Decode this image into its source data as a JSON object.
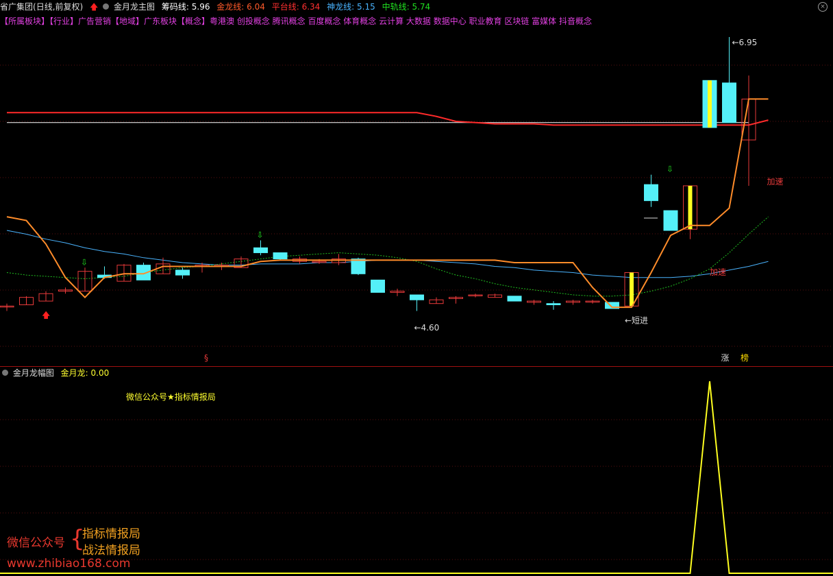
{
  "header": {
    "stock": "省广集团",
    "period": "(日线,前复权)",
    "indicator": "金月龙主图",
    "chip_label": "筹码线:",
    "chip_value": "5.96",
    "gold_label": "金龙线:",
    "gold_value": "6.04",
    "plat_label": "平台线:",
    "plat_value": "6.34",
    "god_label": "神龙线:",
    "god_value": "5.15",
    "mid_label": "中轨线:",
    "mid_value": "5.74"
  },
  "concepts": "【所属板块】【行业】广告营销【地域】广东板块【概念】粤港澳 创投概念 腾讯概念 百度概念 体育概念 云计算 大数据 数据中心 职业教育 区块链 富媒体 抖音概念",
  "subpanel": {
    "title": "金月龙幅图",
    "value_label": "金月龙:",
    "value": "0.00",
    "note": "微信公众号★指标情报局"
  },
  "watermark": {
    "label": "微信公众号",
    "brace": "{",
    "line1": "指标情报局",
    "line2": "战法情报局",
    "url": "www.zhibiao168.com"
  },
  "colors": {
    "up": "#e83a3a",
    "down": "#54f0f8",
    "gold": "#ff8c2a",
    "plat": "#ff2a2a",
    "god": "#4ab4ff",
    "mid": "#20c020",
    "signal": "#ffff20"
  },
  "chart_data": {
    "type": "candlestick",
    "y_range": [
      4.4,
      7.0
    ],
    "annotations": {
      "high": "6.95",
      "low": "4.60",
      "short_entry": "←短进",
      "accel_1": "加速",
      "accel_2": "加速",
      "mark_s": "§",
      "mark_zhang": "涨",
      "mark_bang": "榜"
    },
    "candles": [
      {
        "o": 4.78,
        "h": 4.8,
        "l": 4.74,
        "c": 4.78
      },
      {
        "o": 4.79,
        "h": 4.86,
        "l": 4.79,
        "c": 4.85
      },
      {
        "o": 4.82,
        "h": 4.9,
        "l": 4.82,
        "c": 4.88
      },
      {
        "o": 4.9,
        "h": 4.93,
        "l": 4.88,
        "c": 4.91
      },
      {
        "o": 4.9,
        "h": 5.09,
        "l": 4.9,
        "c": 5.06
      },
      {
        "o": 5.03,
        "h": 5.1,
        "l": 5.0,
        "c": 5.01
      },
      {
        "o": 4.98,
        "h": 5.12,
        "l": 4.98,
        "c": 5.11
      },
      {
        "o": 5.11,
        "h": 5.13,
        "l": 4.99,
        "c": 4.99
      },
      {
        "o": 5.04,
        "h": 5.17,
        "l": 5.04,
        "c": 5.12
      },
      {
        "o": 5.07,
        "h": 5.09,
        "l": 5.0,
        "c": 5.03
      },
      {
        "o": 5.1,
        "h": 5.13,
        "l": 5.05,
        "c": 5.11
      },
      {
        "o": 5.1,
        "h": 5.13,
        "l": 5.07,
        "c": 5.11
      },
      {
        "o": 5.09,
        "h": 5.18,
        "l": 5.09,
        "c": 5.16
      },
      {
        "o": 5.25,
        "h": 5.31,
        "l": 5.19,
        "c": 5.21
      },
      {
        "o": 5.21,
        "h": 5.21,
        "l": 5.15,
        "c": 5.16
      },
      {
        "o": 5.14,
        "h": 5.18,
        "l": 5.12,
        "c": 5.16
      },
      {
        "o": 5.14,
        "h": 5.16,
        "l": 5.12,
        "c": 5.14
      },
      {
        "o": 5.13,
        "h": 5.2,
        "l": 5.11,
        "c": 5.16
      },
      {
        "o": 5.16,
        "h": 5.17,
        "l": 5.03,
        "c": 5.04
      },
      {
        "o": 4.99,
        "h": 4.99,
        "l": 4.89,
        "c": 4.89
      },
      {
        "o": 4.89,
        "h": 4.92,
        "l": 4.86,
        "c": 4.9
      },
      {
        "o": 4.87,
        "h": 4.87,
        "l": 4.74,
        "c": 4.83
      },
      {
        "o": 4.8,
        "h": 4.85,
        "l": 4.8,
        "c": 4.83
      },
      {
        "o": 4.84,
        "h": 4.86,
        "l": 4.8,
        "c": 4.85
      },
      {
        "o": 4.87,
        "h": 4.88,
        "l": 4.85,
        "c": 4.87
      },
      {
        "o": 4.85,
        "h": 4.88,
        "l": 4.85,
        "c": 4.87
      },
      {
        "o": 4.86,
        "h": 4.86,
        "l": 4.82,
        "c": 4.82
      },
      {
        "o": 4.81,
        "h": 4.83,
        "l": 4.79,
        "c": 4.82
      },
      {
        "o": 4.8,
        "h": 4.82,
        "l": 4.75,
        "c": 4.79
      },
      {
        "o": 4.81,
        "h": 4.83,
        "l": 4.79,
        "c": 4.82
      },
      {
        "o": 4.82,
        "h": 4.83,
        "l": 4.8,
        "c": 4.82
      },
      {
        "o": 4.81,
        "h": 4.81,
        "l": 4.76,
        "c": 4.76
      },
      {
        "o": 4.78,
        "h": 5.05,
        "l": 4.78,
        "c": 5.05
      },
      {
        "o": 5.76,
        "h": 5.84,
        "l": 5.58,
        "c": 5.63
      },
      {
        "o": 5.55,
        "h": 5.55,
        "l": 5.39,
        "c": 5.39
      },
      {
        "o": 5.4,
        "h": 5.75,
        "l": 5.32,
        "c": 5.75
      },
      {
        "o": 6.6,
        "h": 6.6,
        "l": 6.22,
        "c": 6.22
      },
      {
        "o": 6.58,
        "h": 6.95,
        "l": 6.26,
        "c": 6.26
      },
      {
        "o": 6.12,
        "h": 6.64,
        "l": 5.75,
        "c": 6.45
      }
    ],
    "signal_bars": [
      32,
      35,
      36
    ],
    "series": {
      "gold": [
        5.5,
        5.47,
        5.28,
        5.01,
        4.85,
        5.01,
        5.04,
        5.04,
        5.1,
        5.1,
        5.1,
        5.1,
        5.1,
        5.14,
        5.15,
        5.15,
        5.15,
        5.15,
        5.15,
        5.15,
        5.15,
        5.15,
        5.15,
        5.15,
        5.15,
        5.15,
        5.13,
        5.13,
        5.13,
        5.13,
        4.93,
        4.77,
        4.77,
        5.05,
        5.35,
        5.43,
        5.43,
        5.57,
        6.45,
        6.45
      ],
      "plat": [
        6.34,
        6.34,
        6.34,
        6.34,
        6.34,
        6.34,
        6.34,
        6.34,
        6.34,
        6.34,
        6.34,
        6.34,
        6.34,
        6.34,
        6.34,
        6.34,
        6.34,
        6.34,
        6.34,
        6.34,
        6.34,
        6.34,
        6.31,
        6.27,
        6.26,
        6.25,
        6.25,
        6.25,
        6.24,
        6.24,
        6.24,
        6.24,
        6.24,
        6.24,
        6.24,
        6.24,
        6.24,
        6.24,
        6.24,
        6.28
      ],
      "god": [
        5.39,
        5.36,
        5.32,
        5.29,
        5.25,
        5.22,
        5.2,
        5.17,
        5.15,
        5.13,
        5.12,
        5.11,
        5.11,
        5.12,
        5.12,
        5.12,
        5.13,
        5.13,
        5.14,
        5.15,
        5.15,
        5.15,
        5.14,
        5.13,
        5.12,
        5.1,
        5.09,
        5.07,
        5.06,
        5.05,
        5.03,
        5.02,
        5.01,
        5.01,
        5.01,
        5.02,
        5.04,
        5.07,
        5.1,
        5.14
      ],
      "mid": [
        5.05,
        5.03,
        5.02,
        5.01,
        5.0,
        5.01,
        5.02,
        5.05,
        5.07,
        5.09,
        5.1,
        5.12,
        5.14,
        5.16,
        5.18,
        5.19,
        5.2,
        5.21,
        5.2,
        5.19,
        5.17,
        5.14,
        5.08,
        5.03,
        5.0,
        4.96,
        4.93,
        4.91,
        4.89,
        4.87,
        4.86,
        4.86,
        4.87,
        4.9,
        4.94,
        5.0,
        5.08,
        5.21,
        5.36,
        5.5
      ],
      "chip": 6.26
    },
    "jinyuelong": [
      0,
      0,
      0,
      0,
      0,
      0,
      0,
      0,
      0,
      0,
      0,
      0,
      0,
      0,
      0,
      0,
      0,
      0,
      0,
      0,
      0,
      0,
      0,
      0,
      0,
      0,
      0,
      0,
      0,
      0,
      0,
      0,
      0,
      0,
      0,
      0,
      1,
      0,
      0,
      0
    ],
    "jinyuelong_range": [
      0,
      1
    ]
  }
}
